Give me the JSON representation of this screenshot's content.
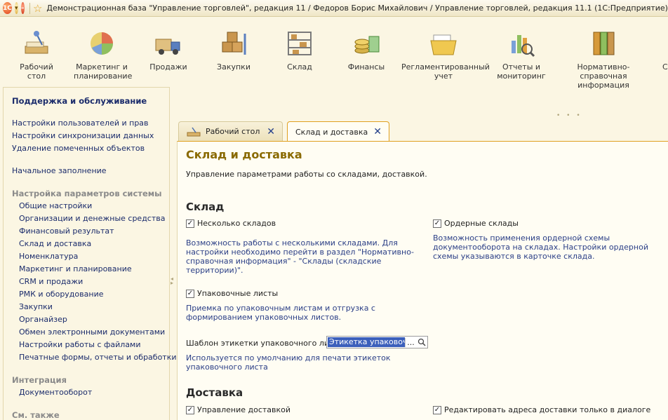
{
  "window": {
    "title": "Демонстрационная база \"Управление торговлей\", редакция 11 / Федоров Борис Михайлович / Управление торговлей, редакция 11.1  (1С:Предприятие)"
  },
  "sections": [
    {
      "label": "Рабочий\nстол",
      "icon": "desk-icon"
    },
    {
      "label": "Маркетинг и\nпланирование",
      "icon": "pie-chart-icon"
    },
    {
      "label": "Продажи",
      "icon": "truck-icon"
    },
    {
      "label": "Закупки",
      "icon": "boxes-icon"
    },
    {
      "label": "Склад",
      "icon": "warehouse-shelf-icon"
    },
    {
      "label": "Финансы",
      "icon": "coins-icon"
    },
    {
      "label": "Регламентированный\nучет",
      "icon": "folder-docs-icon"
    },
    {
      "label": "Отчеты и\nмониторинг",
      "icon": "bar-chart-magnifier-icon"
    },
    {
      "label": "Нормативно-справочная\nинформация",
      "icon": "binders-icon"
    }
  ],
  "left_panel": {
    "heading": "Поддержка и обслуживание",
    "links_top": [
      "Настройки пользователей и прав",
      "Настройки синхронизации данных",
      "Удаление помеченных объектов"
    ],
    "link_initial": "Начальное заполнение",
    "group_system": "Настройка параметров системы",
    "system_items": [
      "Общие настройки",
      "Организации и денежные средства",
      "Финансовый результат",
      "Склад и доставка",
      "Номенклатура",
      "Маркетинг и планирование",
      "CRM и продажи",
      "РМК и оборудование",
      "Закупки",
      "Органайзер",
      "Обмен электронными документами",
      "Настройки работы с файлами",
      "Печатные формы, отчеты и обработки"
    ],
    "group_integration": "Интеграция",
    "integration_items": [
      "Документооборот"
    ],
    "group_see_also": "См. также"
  },
  "tabs": [
    {
      "label": "Рабочий стол",
      "active": false
    },
    {
      "label": "Склад и доставка",
      "active": true
    }
  ],
  "content": {
    "title": "Склад и доставка",
    "subtitle": "Управление параметрами работы со складами, доставкой.",
    "section_warehouse": "Склад",
    "multi_warehouse": {
      "label": "Несколько складов",
      "checked": true,
      "hint": "Возможность работы с несколькими складами. Для настройки необходимо перейти в раздел \"Нормативно-справочная информация\" - \"Склады (складские территории)\"."
    },
    "order_warehouses": {
      "label": "Ордерные склады",
      "checked": true,
      "hint": "Возможность применения ордерной схемы документооборота на складах. Настройки ордерной схемы указываются в карточке склада."
    },
    "packing_lists": {
      "label": "Упаковочные листы",
      "checked": true,
      "hint": "Приемка по упаковочным листам и отгрузка с формированием упаковочных листов."
    },
    "label_template": {
      "label": "Шаблон этикетки упаковочного листа:",
      "value": "Этикетка упаковочн",
      "hint": "Используется по умолчанию для печати этикеток упаковочного листа"
    },
    "section_delivery": "Доставка",
    "delivery_management": {
      "label": "Управление доставкой",
      "checked": true
    },
    "edit_address_dialog": {
      "label": "Редактировать адреса доставки только в диалоге",
      "checked": true
    }
  }
}
